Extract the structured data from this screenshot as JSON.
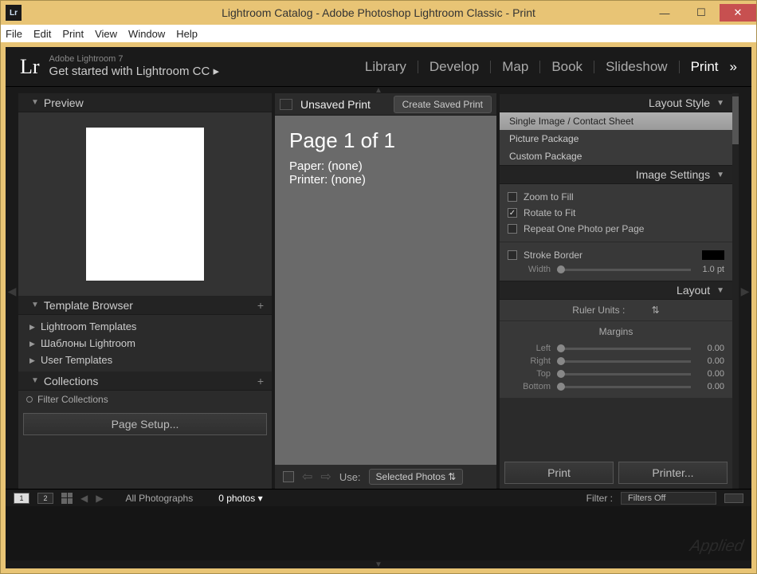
{
  "titlebar": {
    "app_icon_text": "Lr",
    "title": "Lightroom Catalog - Adobe Photoshop Lightroom Classic - Print"
  },
  "menubar": [
    "File",
    "Edit",
    "Print",
    "View",
    "Window",
    "Help"
  ],
  "header": {
    "logo": "Lr",
    "tagline_small": "Adobe Lightroom 7",
    "tagline_main": "Get started with Lightroom CC ▸",
    "modules": [
      "Library",
      "Develop",
      "Map",
      "Book",
      "Slideshow",
      "Print"
    ],
    "active_module": "Print"
  },
  "left": {
    "preview_title": "Preview",
    "template_browser_title": "Template Browser",
    "template_items": [
      "Lightroom Templates",
      "Шаблоны Lightroom",
      "User Templates"
    ],
    "collections_title": "Collections",
    "filter_collections": "Filter Collections",
    "page_setup": "Page Setup..."
  },
  "center": {
    "unsaved": "Unsaved Print",
    "create_saved": "Create Saved Print",
    "page_heading": "Page 1 of 1",
    "paper_line": "Paper: (none)",
    "printer_line": "Printer: (none)",
    "use_label": "Use:",
    "use_value": "Selected Photos"
  },
  "right": {
    "layout_style_title": "Layout Style",
    "layout_styles": [
      "Single Image / Contact Sheet",
      "Picture Package",
      "Custom Package"
    ],
    "active_style": "Single Image / Contact Sheet",
    "image_settings_title": "Image Settings",
    "zoom_to_fill": "Zoom to Fill",
    "rotate_to_fit": "Rotate to Fit",
    "repeat_one": "Repeat One Photo per Page",
    "stroke_border": "Stroke Border",
    "width_label": "Width",
    "width_value": "1.0 pt",
    "layout_title": "Layout",
    "ruler_units": "Ruler Units :",
    "margins_title": "Margins",
    "margin_left_label": "Left",
    "margin_right_label": "Right",
    "margin_top_label": "Top",
    "margin_bottom_label": "Bottom",
    "margin_value": "0.00",
    "print_btn": "Print",
    "printer_btn": "Printer..."
  },
  "filmstrip": {
    "view1": "1",
    "view2": "2",
    "source": "All Photographs",
    "count": "0 photos ▾",
    "filter_label": "Filter :",
    "filter_value": "Filters Off"
  }
}
